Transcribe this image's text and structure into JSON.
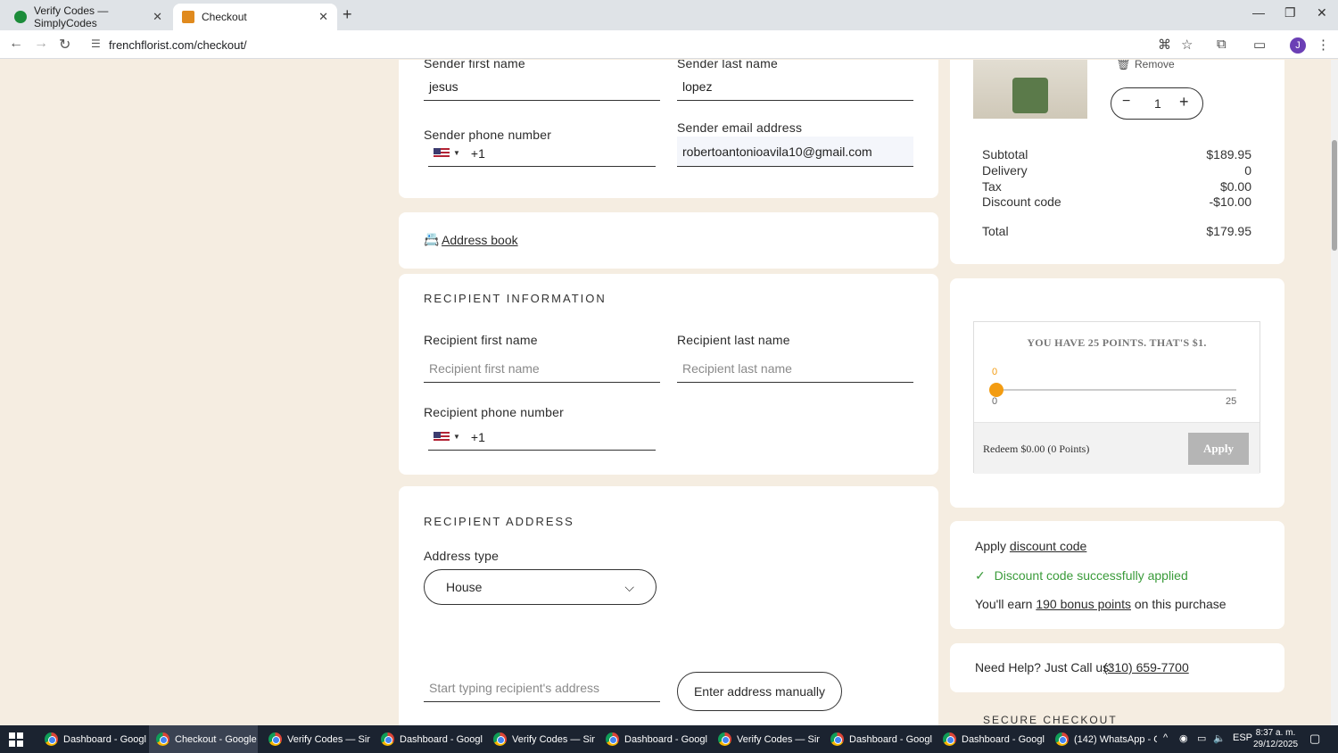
{
  "browser": {
    "tabs": [
      {
        "title": "Verify Codes — SimplyCodes",
        "active": false
      },
      {
        "title": "Checkout",
        "active": true
      }
    ],
    "url": "frenchflorist.com/checkout/"
  },
  "sender": {
    "first_name_label": "Sender first name",
    "first_name_value": "jesus",
    "last_name_label": "Sender last name",
    "last_name_value": "lopez",
    "phone_label": "Sender phone number",
    "phone_code": "+1",
    "email_label": "Sender email address",
    "email_value": "robertoantonioavila10@gmail.com"
  },
  "address_book": {
    "label": "Address book"
  },
  "recipient": {
    "title": "RECIPIENT INFORMATION",
    "first_name_label": "Recipient first name",
    "first_name_placeholder": "Recipient first name",
    "last_name_label": "Recipient last name",
    "last_name_placeholder": "Recipient last name",
    "phone_label": "Recipient phone number",
    "phone_code": "+1"
  },
  "recipient_address": {
    "title": "RECIPIENT ADDRESS",
    "type_label": "Address type",
    "type_value": "House",
    "search_placeholder": "Start typing recipient's address",
    "manual_button": "Enter address manually"
  },
  "cart": {
    "remove_label": "Remove",
    "quantity": "1",
    "subtotal_label": "Subtotal",
    "subtotal_value": "$189.95",
    "delivery_label": "Delivery",
    "delivery_value": "0",
    "tax_label": "Tax",
    "tax_value": "$0.00",
    "discount_label": "Discount code",
    "discount_value": "-$10.00",
    "total_label": "Total",
    "total_value": "$179.95"
  },
  "points": {
    "title": "YOU HAVE 25 POINTS. THAT'S $1.",
    "current": "0",
    "min": "0",
    "max": "25",
    "redeem_text": "Redeem $0.00 (0 Points)",
    "apply": "Apply"
  },
  "discount": {
    "apply_prefix": "Apply",
    "apply_link": "discount code",
    "success": "Discount code successfully applied",
    "earn_prefix": "You'll earn",
    "earn_link": "190 bonus points",
    "earn_suffix": "on this purchase"
  },
  "help": {
    "text": "Need Help? Just Call us:",
    "phone": "(310) 659-7700"
  },
  "secure_checkout": "SECURE CHECKOUT",
  "taskbar": {
    "tasks": [
      "Dashboard - Googl...",
      "Checkout - Google ...",
      "Verify Codes — Sim...",
      "Dashboard - Googl...",
      "Verify Codes — Sim...",
      "Dashboard - Googl...",
      "Verify Codes — Sim...",
      "Dashboard - Googl...",
      "Dashboard - Googl...",
      "(142) WhatsApp - G..."
    ],
    "language": "ESP",
    "time": "8:37 a. m.",
    "date": "29/12/2025"
  },
  "colors": {
    "page_bg": "#f5ede1",
    "card_bg": "#ffffff",
    "slider_accent": "#f39c12",
    "success_green": "#3a9b3a",
    "apply_disabled": "#b5b5b5"
  }
}
